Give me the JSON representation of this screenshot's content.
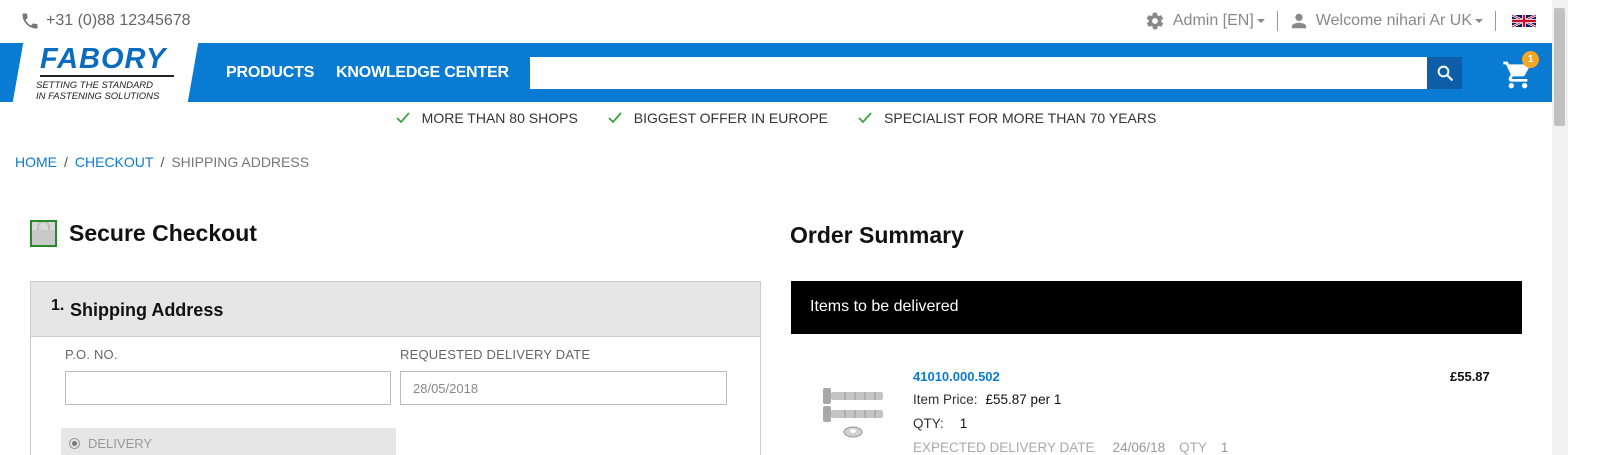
{
  "topbar": {
    "phone": "+31 (0)88 12345678",
    "admin": "Admin [EN]",
    "welcome": "Welcome nihari Ar UK",
    "flag_icon": "uk-flag-icon"
  },
  "nav": {
    "brand": "FABORY",
    "tagline_line1": "SETTING THE STANDARD",
    "tagline_line2": "IN FASTENING SOLUTIONS",
    "products": "PRODUCTS",
    "knowledge": "KNOWLEDGE CENTER",
    "search_placeholder": "",
    "cart_count": "1",
    "brand_color": "#0a7bd3"
  },
  "usps": [
    "MORE THAN 80 SHOPS",
    "BIGGEST OFFER IN EUROPE",
    "SPECIALIST FOR MORE THAN 70 YEARS"
  ],
  "breadcrumb": {
    "home": "HOME",
    "checkout": "CHECKOUT",
    "current": "SHIPPING ADDRESS"
  },
  "checkout": {
    "title": "Secure Checkout",
    "step_number": "1.",
    "step_title": "Shipping Address",
    "po_label": "P.O. NO.",
    "po_value": "",
    "delivery_date_label": "REQUESTED DELIVERY DATE",
    "delivery_date_value": "28/05/2018",
    "delivery_option": "DELIVERY"
  },
  "summary": {
    "title": "Order Summary",
    "bar_label": "Items to be delivered",
    "item": {
      "code": "41010.000.502",
      "total": "£55.87",
      "price_label": "Item Price:",
      "price_value": "£55.87  per 1",
      "qty_label": "QTY:",
      "qty_value": "1",
      "expected_label": "EXPECTED DELIVERY DATE",
      "expected_value": "24/06/18",
      "expected_qty_label": "QTY",
      "expected_qty_value": "1"
    }
  }
}
